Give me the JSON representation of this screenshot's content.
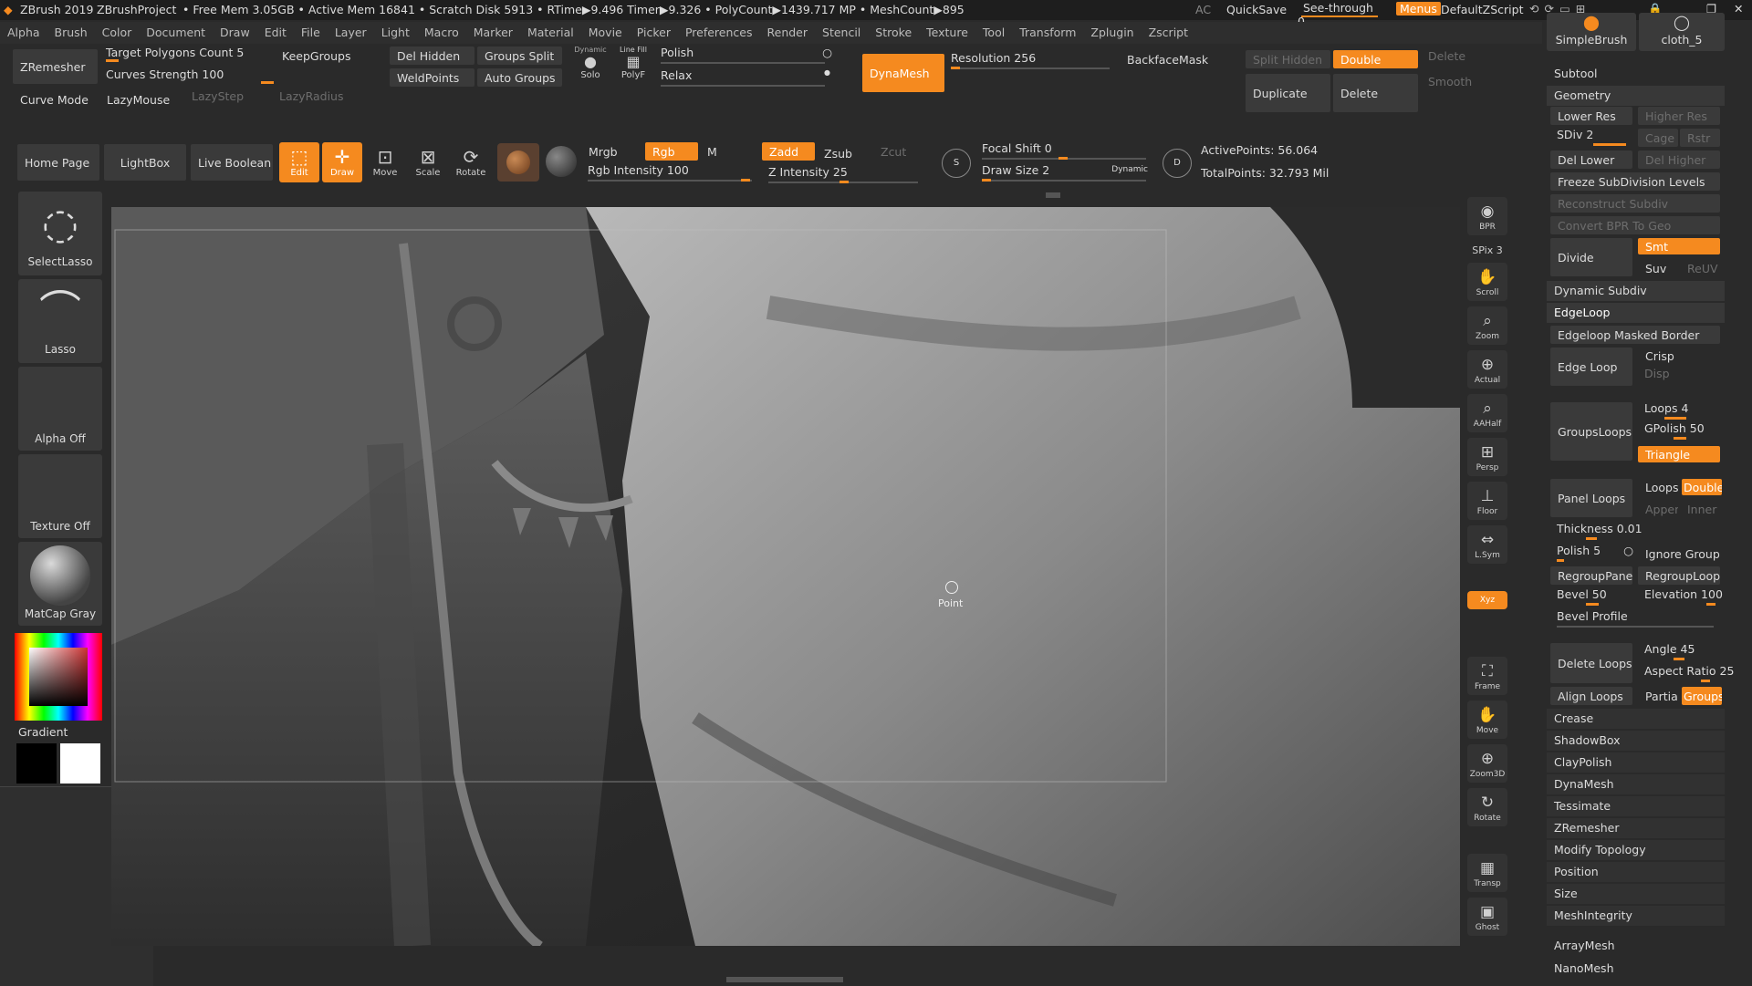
{
  "titlebar": {
    "app": "ZBrush 2019",
    "project": "ZBrushProject",
    "stats": "• Free Mem 3.05GB • Active Mem 16841 • Scratch Disk 5913 • RTime▶9.496 Timer▶9.326 • PolyCount▶1439.717 MP • MeshCount▶895",
    "ac": "AC",
    "quicksave": "QuickSave",
    "seethrough": "See-through  0",
    "menus": "Menus",
    "script": "DefaultZScript"
  },
  "menubar": [
    "Alpha",
    "Brush",
    "Color",
    "Document",
    "Draw",
    "Edit",
    "File",
    "Layer",
    "Light",
    "Macro",
    "Marker",
    "Material",
    "Movie",
    "Picker",
    "Preferences",
    "Render",
    "Stencil",
    "Stroke",
    "Texture",
    "Tool",
    "Transform",
    "Zplugin",
    "Zscript"
  ],
  "shelf": {
    "zremesher": "ZRemesher",
    "target_polygons": "Target Polygons Count 5",
    "curves_strength": "Curves Strength 100",
    "keepgroups": "KeepGroups",
    "curve_mode": "Curve Mode",
    "lazymouse": "LazyMouse",
    "lazystep": "LazyStep",
    "lazyradius": "LazyRadius",
    "del_hidden": "Del Hidden",
    "groups_split": "Groups Split",
    "weldpoints": "WeldPoints",
    "auto_groups": "Auto Groups",
    "solo_top": "Dynamic",
    "solo": "Solo",
    "linefill": "Line Fill",
    "polyf": "PolyF",
    "polish": "Polish",
    "relax": "Relax",
    "dynamesh": "DynaMesh",
    "resolution": "Resolution 256",
    "backfacemask": "BackfaceMask",
    "split_hidden": "Split Hidden",
    "double": "Double",
    "delete_top": "Delete",
    "duplicate": "Duplicate",
    "delete": "Delete",
    "smooth": "Smooth"
  },
  "toolbar": {
    "home_page": "Home Page",
    "lightbox": "LightBox",
    "live_boolean": "Live Boolean",
    "edit": "Edit",
    "draw": "Draw",
    "move": "Move",
    "scale": "Scale",
    "rotate": "Rotate",
    "mrgb": "Mrgb",
    "rgb": "Rgb",
    "m": "M",
    "rgb_intensity": "Rgb Intensity 100",
    "zadd": "Zadd",
    "zsub": "Zsub",
    "zcut": "Zcut",
    "z_intensity": "Z Intensity 25",
    "focal_shift": "Focal Shift 0",
    "draw_size": "Draw Size 2",
    "dynamic": "Dynamic",
    "active_points": "ActivePoints: 56.064",
    "total_points": "TotalPoints: 32.793 Mil"
  },
  "left": {
    "selectlasso": "SelectLasso",
    "lasso": "Lasso",
    "alpha_off": "Alpha Off",
    "texture_off": "Texture Off",
    "matcap": "MatCap Gray",
    "gradient": "Gradient"
  },
  "canvas": {
    "point_label": "Point"
  },
  "righttools": [
    "BPR",
    "SPix 3",
    "Scroll",
    "Zoom",
    "Actual",
    "AAHalf",
    "Persp",
    "Floor",
    "L.Sym",
    "",
    "Xyz",
    "",
    "",
    "Frame",
    "Move",
    "Zoom3D",
    "Rotate",
    "",
    "Transp",
    "Ghost"
  ],
  "brushes": {
    "simple": "SimpleBrush",
    "cloth": "cloth_5"
  },
  "panel": {
    "subtool": "Subtool",
    "geometry": "Geometry",
    "lower_res": "Lower Res",
    "higher_res": "Higher Res",
    "sdiv": "SDiv 2",
    "cage": "Cage",
    "rstr": "Rstr",
    "del_lower": "Del Lower",
    "del_higher": "Del Higher",
    "freeze": "Freeze SubDivision Levels",
    "reconstruct": "Reconstruct Subdiv",
    "convert_bpr": "Convert BPR To Geo",
    "divide": "Divide",
    "smt": "Smt",
    "suv": "Suv",
    "reuv": "ReUV",
    "dynamic_subdiv": "Dynamic Subdiv",
    "edgeloop": "EdgeLoop",
    "edgeloop_masked": "Edgeloop Masked Border",
    "edge_loop": "Edge Loop",
    "crisp": "Crisp",
    "disp": "Disp",
    "groupsloops": "GroupsLoops",
    "loops4": "Loops 4",
    "gpolish": "GPolish 50",
    "triangle": "Triangle",
    "panel_loops": "Panel Loops",
    "loops": "Loops",
    "double": "Double",
    "append": "Append",
    "inner": "Inner",
    "thickness": "Thickness 0.01",
    "polish5": "Polish 5",
    "ignore_groups": "Ignore Groups",
    "regroup_panels": "RegroupPanels",
    "regroup_loops": "RegroupLoops",
    "bevel": "Bevel 50",
    "elevation": "Elevation 100",
    "bevel_profile": "Bevel Profile",
    "delete_loops": "Delete Loops",
    "angle": "Angle 45",
    "aspect": "Aspect Ratio 25",
    "align_loops": "Align Loops",
    "partial": "Partial",
    "groups": "Groups",
    "list": [
      "Crease",
      "ShadowBox",
      "ClayPolish",
      "DynaMesh",
      "Tessimate",
      "ZRemesher",
      "Modify Topology",
      "Position",
      "Size",
      "MeshIntegrity"
    ],
    "arraymesh": "ArrayMesh",
    "nanomesh": "NanoMesh"
  },
  "colors": {
    "accent": "#f58a1f",
    "panel": "#313131",
    "bg": "#2a2a2a"
  }
}
